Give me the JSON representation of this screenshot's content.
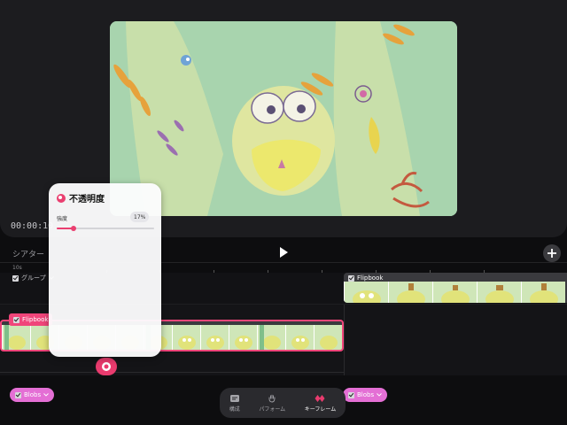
{
  "preview": {
    "time": "00:00:10"
  },
  "timeline": {
    "theater_label": "シアター",
    "ruler_number": "10s",
    "group_label": "グループ",
    "group_chevron": "chevron-down-icon",
    "flipbook_label": "Flipbook",
    "blobs_label": "Blobs"
  },
  "opacity_panel": {
    "title": "不透明度",
    "strength_label": "強度",
    "strength_value": "17%",
    "strength_fraction": 0.17
  },
  "bottom_bar": {
    "tabs": [
      {
        "label": "構成",
        "icon": "composition-icon",
        "active": false
      },
      {
        "label": "パフォーム",
        "icon": "hand-icon",
        "active": false
      },
      {
        "label": "キーフレーム",
        "icon": "keyframe-icon",
        "active": true
      }
    ]
  },
  "colors": {
    "accent": "#ea3f70",
    "blobs": "#e46fd5",
    "video_bg": "#a9d5b0"
  }
}
